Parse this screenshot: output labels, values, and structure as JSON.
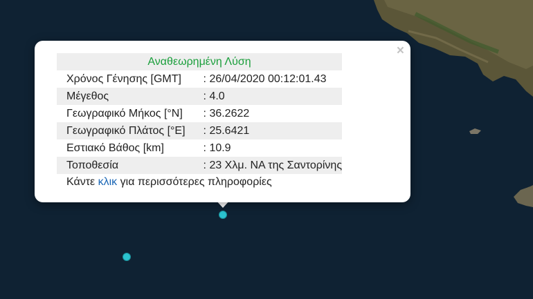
{
  "map": {
    "water_color": "#0f2233",
    "land_color": "#5e5a3c",
    "marker_color": "#2bc3cf"
  },
  "popup": {
    "close_icon": "×",
    "title": "Αναθεωρημένη Λύση",
    "rows": [
      {
        "label": "Χρόνος Γένησης [GMT]",
        "value": "26/04/2020 00:12:01.43"
      },
      {
        "label": "Μέγεθος",
        "value": "4.0"
      },
      {
        "label": "Γεωγραφικό Μήκος [°N]",
        "value": "36.2622"
      },
      {
        "label": "Γεωγραφικό Πλάτος [°E]",
        "value": "25.6421"
      },
      {
        "label": "Εστιακό Βάθος [km]",
        "value": "10.9"
      },
      {
        "label": "Τοποθεσία",
        "value": "23 Χλμ. ΝΑ της Σαντορίνης"
      }
    ],
    "footer_prefix": "Κάντε ",
    "footer_link": "κλικ",
    "footer_suffix": " για περισσότερες πληροφορίες"
  }
}
